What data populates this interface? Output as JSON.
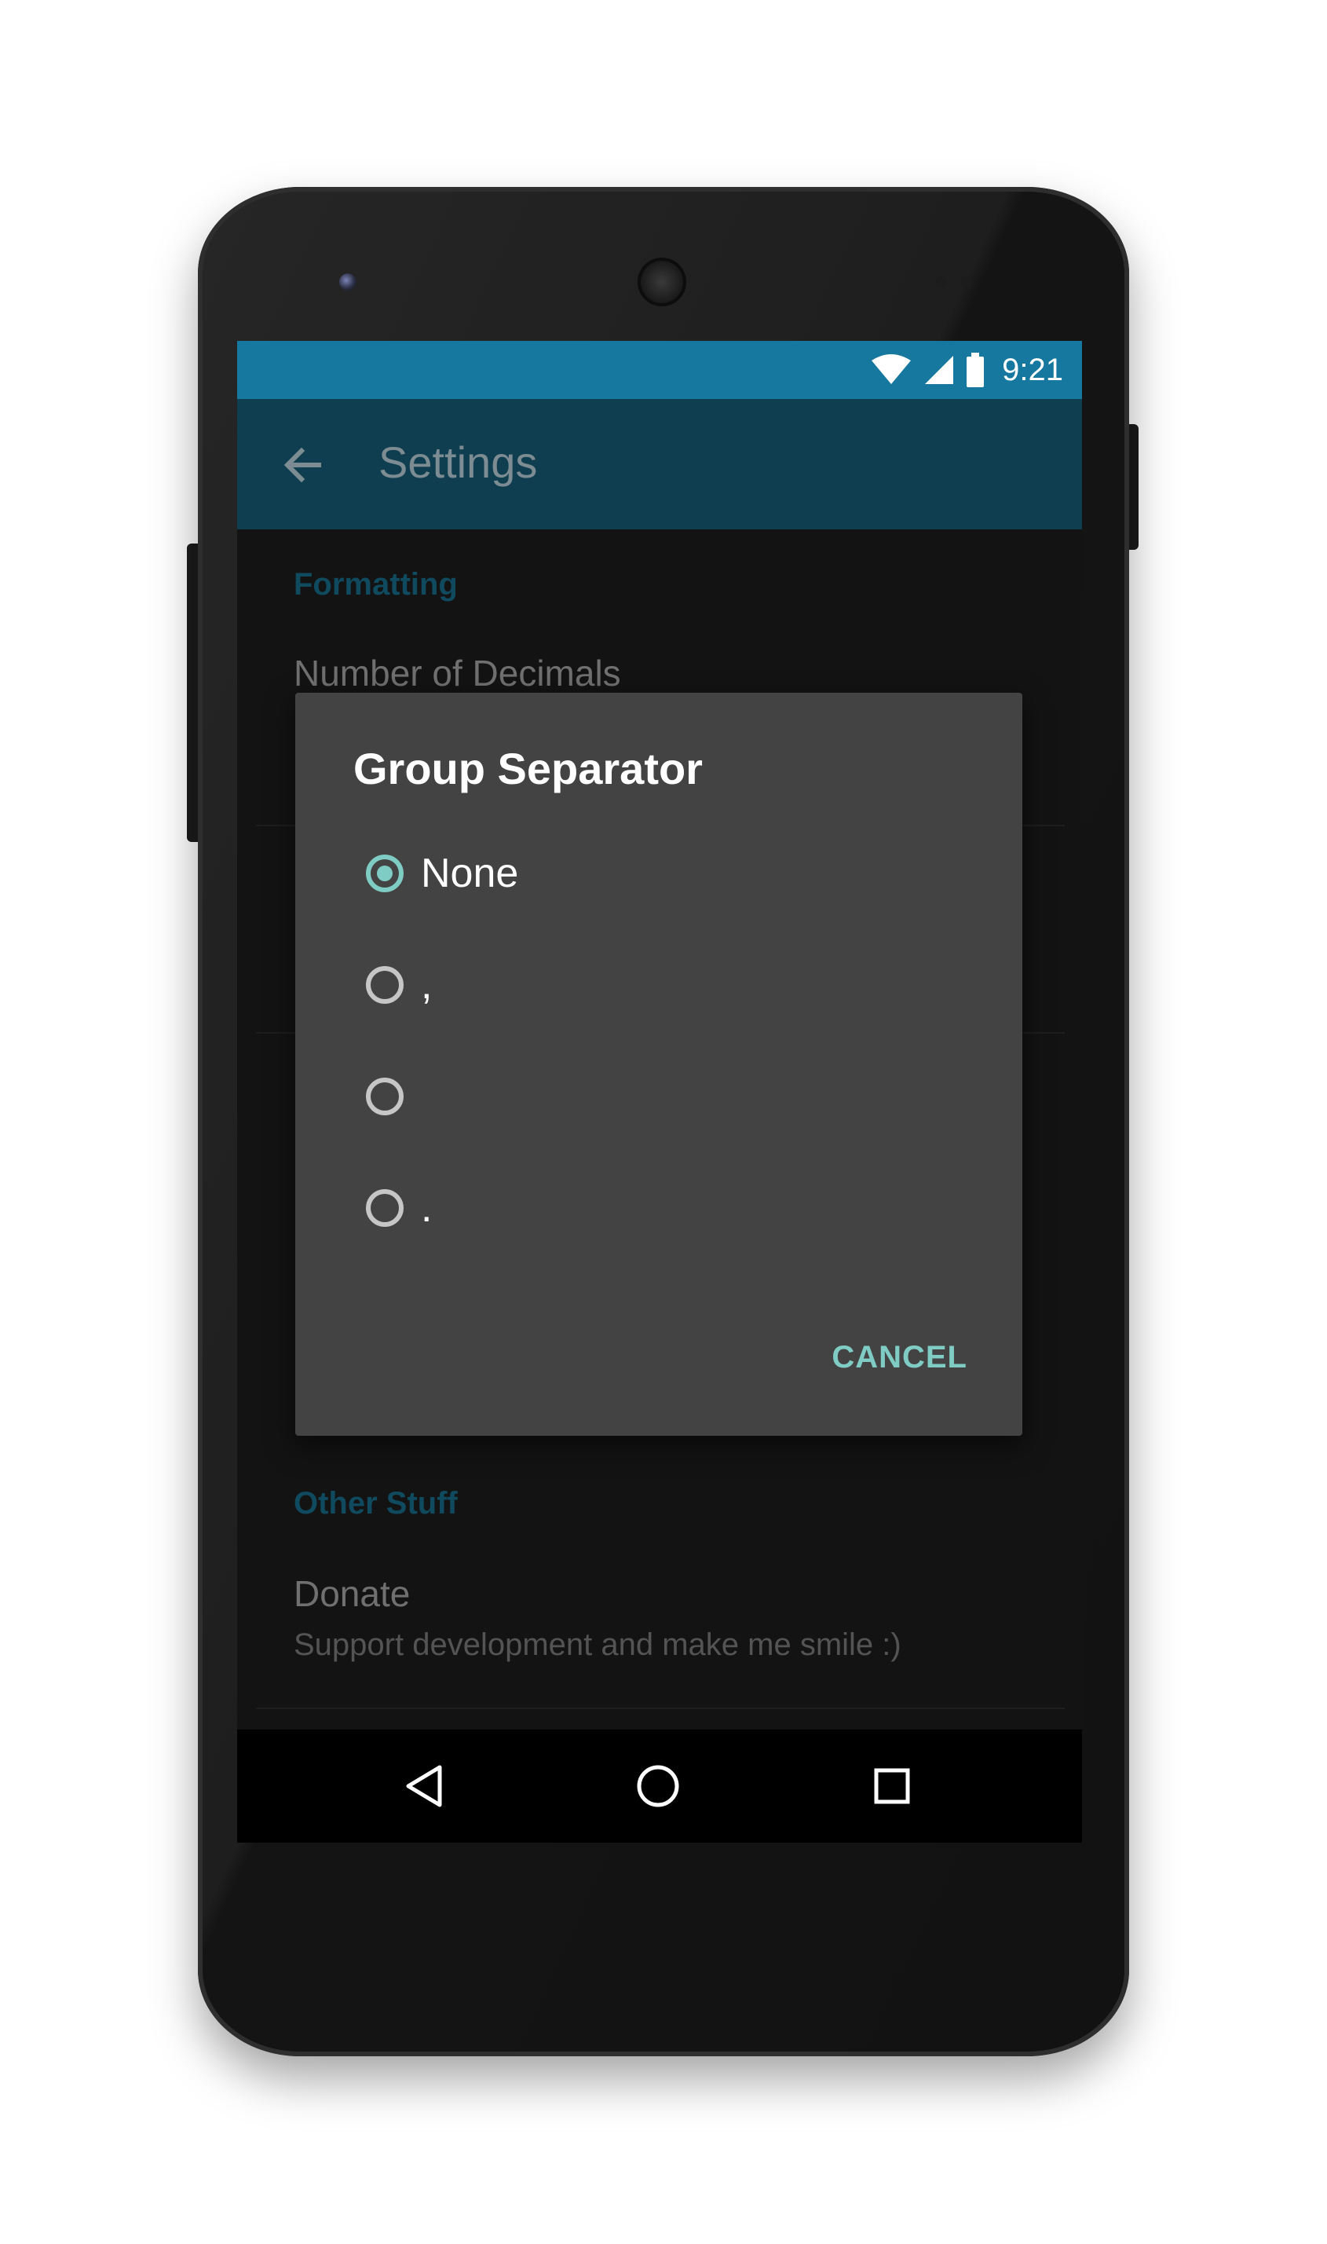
{
  "status_bar": {
    "time": "9:21",
    "icons": [
      "wifi-icon",
      "cellular-signal-icon",
      "battery-icon"
    ]
  },
  "toolbar": {
    "title": "Settings",
    "back_icon": "arrow-left-icon"
  },
  "preferences": {
    "formatting_header": "Formatting",
    "number_of_decimals_title": "Number of Decimals",
    "other_stuff_header": "Other Stuff",
    "donate_title": "Donate",
    "donate_summary": "Support development and make me smile :)"
  },
  "dialog": {
    "title": "Group Separator",
    "options": [
      {
        "label": "None",
        "checked": true
      },
      {
        "label": ",",
        "checked": false
      },
      {
        "label": "",
        "checked": false
      },
      {
        "label": ".",
        "checked": false
      }
    ],
    "cancel_label": "CANCEL"
  },
  "nav_bar": {
    "icons": [
      "back-triangle-icon",
      "home-circle-icon",
      "recents-square-icon"
    ]
  },
  "colors": {
    "status_bar": "#16789e",
    "toolbar": "#0e3e50",
    "dialog_background": "#434343",
    "accent": "#7fccc4"
  }
}
